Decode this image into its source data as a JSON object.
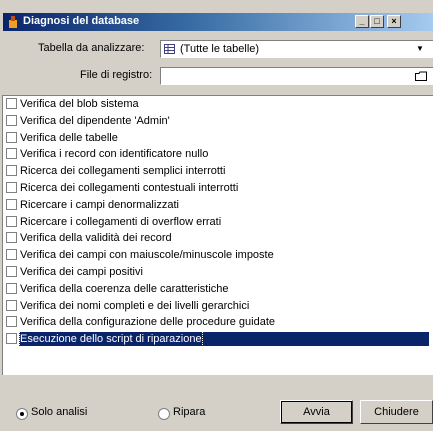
{
  "window": {
    "title": "Diagnosi del database",
    "controls": [
      "_",
      "□",
      "×"
    ]
  },
  "form": {
    "table_label": "Tabella da analizzare:",
    "table_value": "(Tutte le tabelle)",
    "log_label": "File di registro:",
    "log_value": ""
  },
  "checks": [
    {
      "label": "Verifica del blob sistema",
      "checked": false
    },
    {
      "label": "Verifica del dipendente 'Admin'",
      "checked": false
    },
    {
      "label": "Verifica delle tabelle",
      "checked": false
    },
    {
      "label": "Verifica i record con identificatore nullo",
      "checked": false
    },
    {
      "label": "Ricerca dei collegamenti semplici interrotti",
      "checked": false
    },
    {
      "label": "Ricerca dei collegamenti contestuali interrotti",
      "checked": false
    },
    {
      "label": "Ricercare i campi denormalizzati",
      "checked": false
    },
    {
      "label": "Ricercare i collegamenti di overflow errati",
      "checked": false
    },
    {
      "label": "Verifica della validità dei record",
      "checked": false
    },
    {
      "label": "Verifica dei campi con maiuscole/minuscole imposte",
      "checked": false
    },
    {
      "label": "Verifica dei campi positivi",
      "checked": false
    },
    {
      "label": "Verifica della coerenza delle caratteristiche",
      "checked": false
    },
    {
      "label": "Verifica dei nomi completi e dei livelli gerarchici",
      "checked": false
    },
    {
      "label": "Verifica della configurazione delle procedure guidate",
      "checked": false
    },
    {
      "label": "Esecuzione dello script di riparazione",
      "checked": false,
      "selected": true
    }
  ],
  "mode": {
    "options": [
      "Solo analisi",
      "Ripara"
    ],
    "selected": "Solo analisi"
  },
  "buttons": {
    "run": "Avvia",
    "close": "Chiudere"
  }
}
